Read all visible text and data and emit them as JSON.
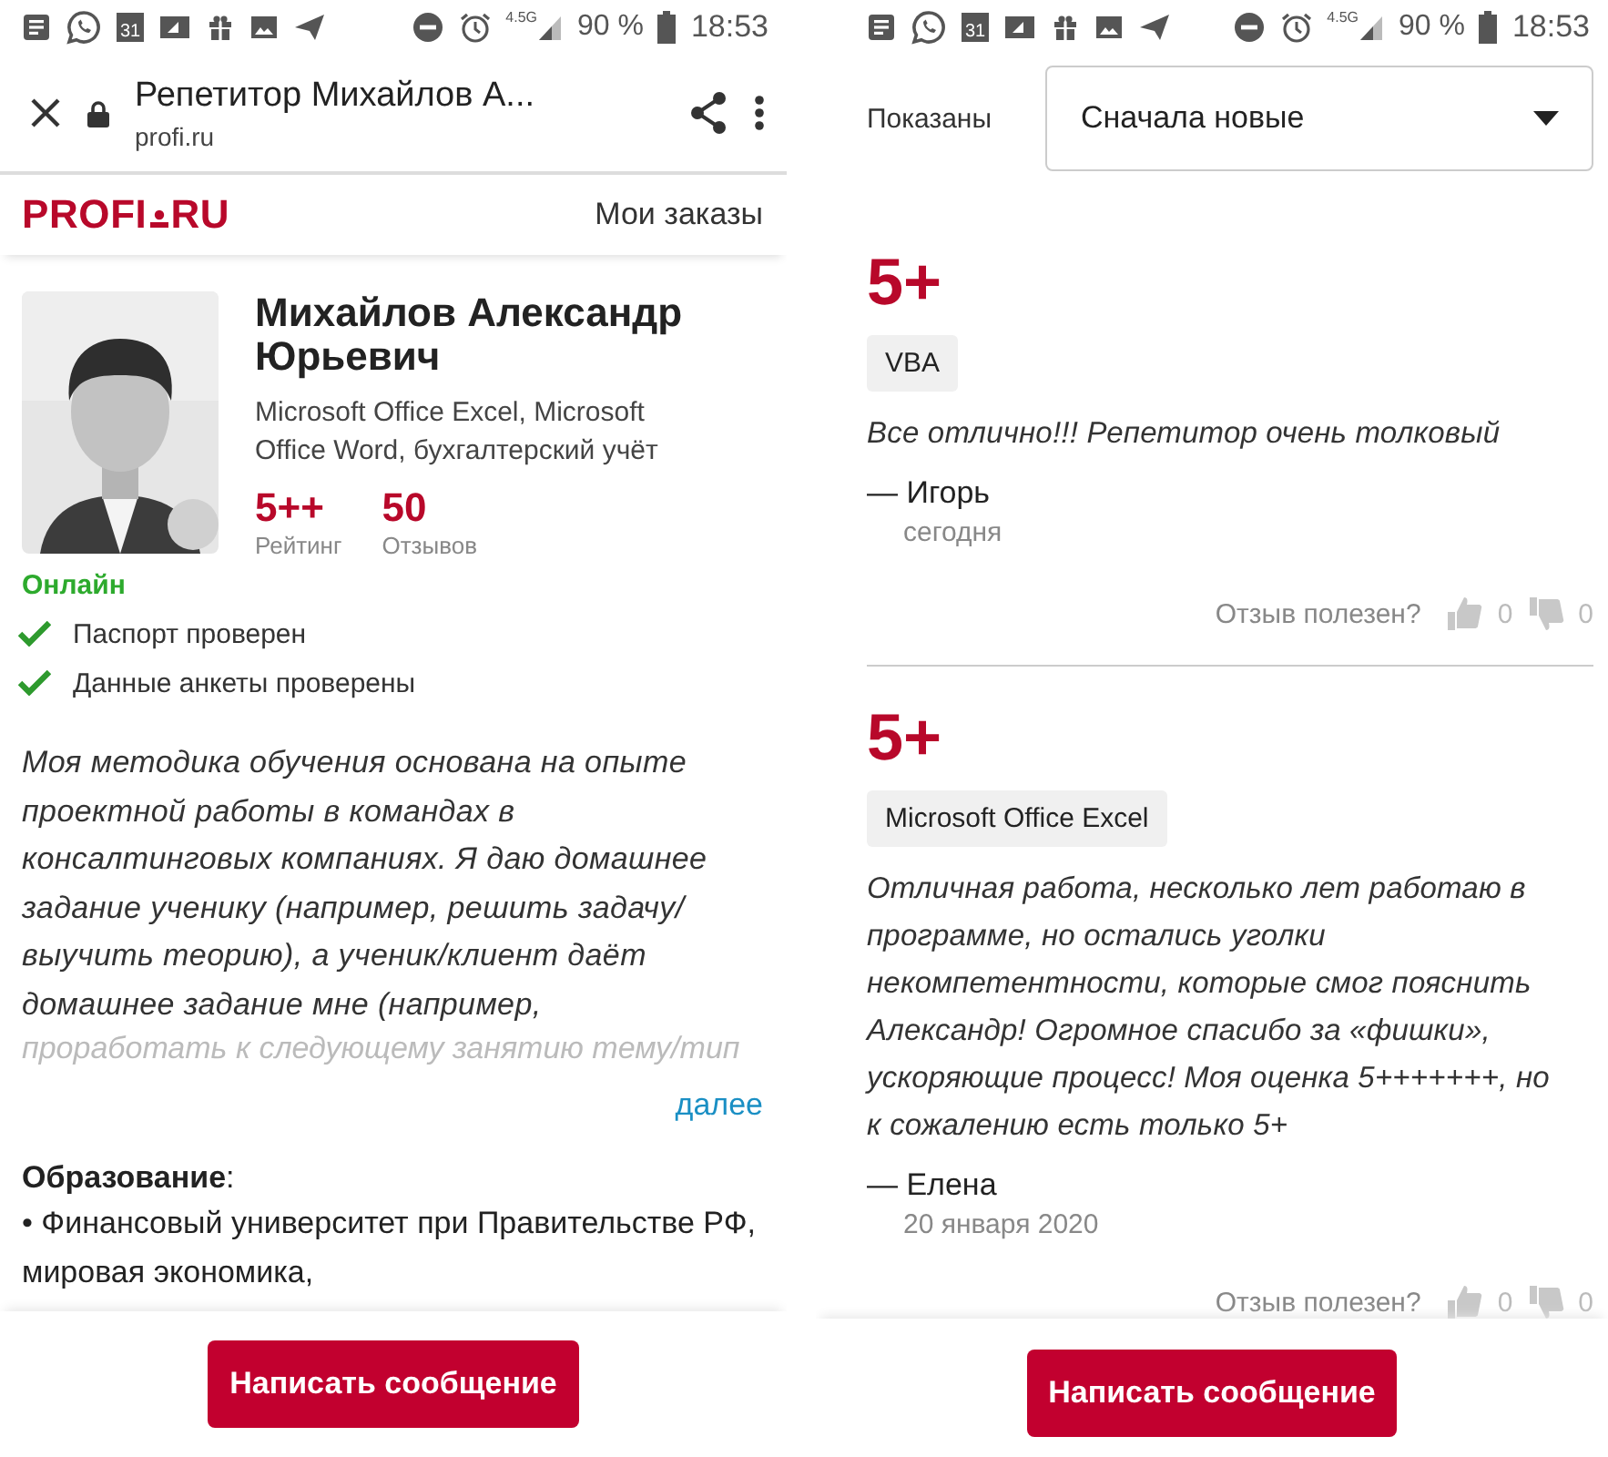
{
  "left_screen": {
    "status_bar": {
      "calendar_day": "31",
      "network": "4.5G",
      "battery": "90 %",
      "time": "18:53"
    },
    "browser_bar": {
      "title": "Репетитор Михайлов А...",
      "url": "profi.ru"
    },
    "header": {
      "logo_left": "PROFI",
      "logo_right": "RU",
      "link": "Мои заказы"
    },
    "profile": {
      "name": "Михайлов Александр Юрьевич",
      "subjects": "Microsoft Office Excel, Microsoft Office Word, бухгалтерский учёт",
      "stats": [
        {
          "value": "5++",
          "label": "Рейтинг"
        },
        {
          "value": "50",
          "label": "Отзывов"
        }
      ],
      "status": "Онлайн",
      "checks": [
        {
          "label": "Паспорт проверен",
          "checked": true
        },
        {
          "label": "Данные анкеты проверены",
          "checked": true
        }
      ]
    },
    "description": "Моя методика обучения основана на опыте проектной работы в командах в консалтинговых компаниях. Я даю домашнее задание ученику (например, решить задачу/ выучить теорию), а ученик/клиент даёт домашнее задание мне (например,",
    "description_faded": "проработать к следующему занятию тему/тип",
    "more_link": "далее",
    "education_title": "**Образование**:",
    "education_text": "• Финансовый университет при Правительстве РФ, мировая экономика,",
    "button": "Написать сообщение"
  },
  "right_screen": {
    "status_bar": {
      "calendar_day": "31",
      "network": "4.5G",
      "battery": "90 %",
      "time": "18:53"
    },
    "sort": {
      "label": "Показаны",
      "value": "Сначала новые"
    },
    "reviews": [
      {
        "grade": "5+",
        "tag": "VBA",
        "text": "Все отлично!!! Репетитор очень толковый",
        "author": "— Игорь",
        "date": "сегодня",
        "helpful_label": "Отзыв полезен?",
        "likes": "0",
        "dislikes": "0"
      },
      {
        "grade": "5+",
        "tag": "Microsoft Office Excel",
        "text": "Отличная работа, несколько лет работаю в программе, но остались уголки некомпетентности, которые смог пояснить Александр! Огромное спасибо за «фишки», ускоряющие процесс! Моя оценка 5+++++++, но к сожалению есть только 5+",
        "author": "— Елена",
        "date": "20 января 2020",
        "helpful_label": "Отзыв полезен?",
        "likes": "0",
        "dislikes": "0"
      }
    ],
    "button": "Написать сообщение"
  }
}
